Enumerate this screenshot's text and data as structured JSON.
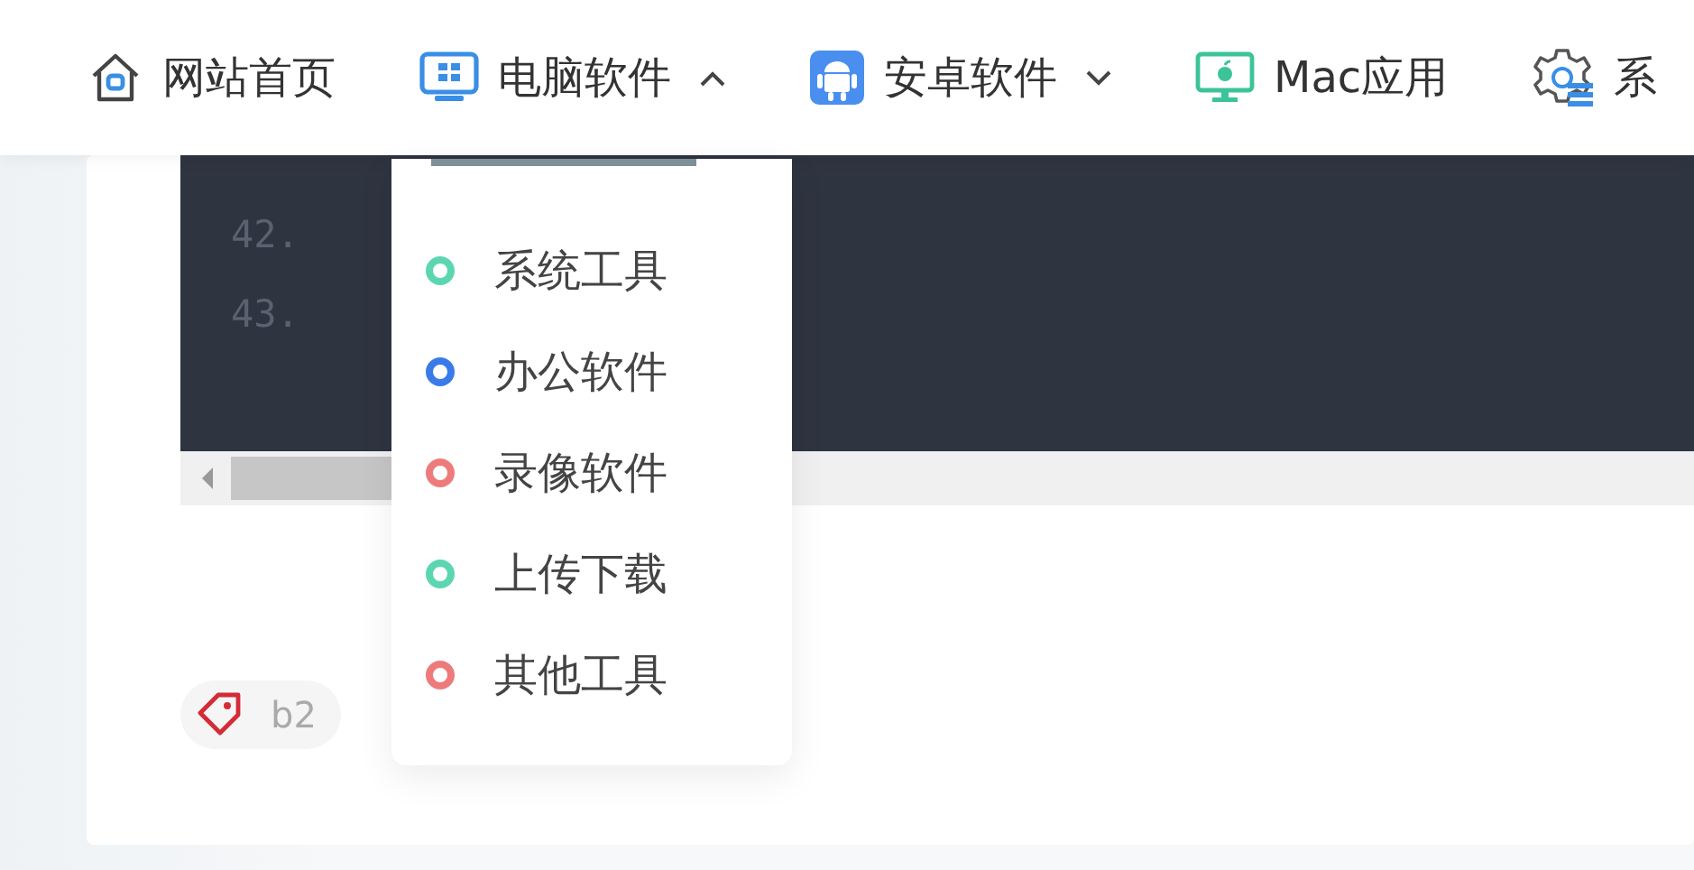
{
  "nav": {
    "items": [
      {
        "label": "网站首页"
      },
      {
        "label": "电脑软件",
        "expanded": true
      },
      {
        "label": "安卓软件",
        "expanded": false
      },
      {
        "label": "Mac应用"
      },
      {
        "label": "系"
      }
    ]
  },
  "dropdown": {
    "items": [
      {
        "label": "系统工具",
        "color": "#5cd6b0"
      },
      {
        "label": "办公软件",
        "color": "#3b7be8"
      },
      {
        "label": "录像软件",
        "color": "#ee7b7b"
      },
      {
        "label": "上传下载",
        "color": "#5cd6b0"
      },
      {
        "label": "其他工具",
        "color": "#ee7b7b"
      }
    ]
  },
  "code": {
    "lines": [
      {
        "number": "42."
      },
      {
        "number": "43."
      }
    ]
  },
  "tags": [
    {
      "label": "b2"
    }
  ]
}
